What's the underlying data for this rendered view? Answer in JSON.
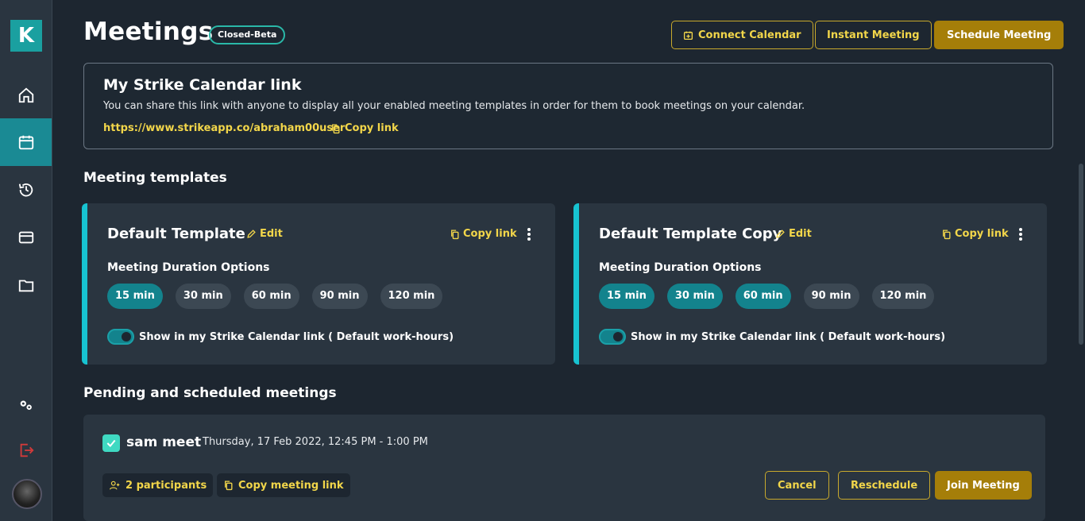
{
  "sidebar": {
    "logo_letter": "K",
    "items": [
      {
        "name": "home",
        "icon": "home-icon"
      },
      {
        "name": "calendar",
        "icon": "calendar-icon",
        "active": true
      },
      {
        "name": "history",
        "icon": "history-icon"
      },
      {
        "name": "card",
        "icon": "card-icon"
      },
      {
        "name": "folder",
        "icon": "folder-icon"
      }
    ],
    "bottom": [
      {
        "name": "settings",
        "icon": "settings-icon"
      },
      {
        "name": "logout",
        "icon": "logout-icon"
      }
    ]
  },
  "header": {
    "title": "Meetings",
    "badge": "Closed-Beta",
    "connect_calendar": "Connect Calendar",
    "instant_meeting": "Instant Meeting",
    "schedule_meeting": "Schedule Meeting"
  },
  "calendar_link": {
    "title": "My Strike Calendar link",
    "description": "You can share this link with anyone to display all your enabled meeting templates in order for them to book meetings on your calendar.",
    "url": "https://www.strikeapp.co/abraham00user",
    "copy_label": "Copy link"
  },
  "templates_section": {
    "title": "Meeting templates",
    "cards": [
      {
        "name": "Default Template",
        "edit_label": "Edit",
        "copy_label": "Copy link",
        "duration_label": "Meeting Duration Options",
        "durations": [
          {
            "label": "15 min",
            "on": true
          },
          {
            "label": "30 min",
            "on": false
          },
          {
            "label": "60 min",
            "on": false
          },
          {
            "label": "90 min",
            "on": false
          },
          {
            "label": "120 min",
            "on": false
          }
        ],
        "toggle_label": "Show in my Strike Calendar link ( Default work-hours)",
        "toggle_on": true
      },
      {
        "name": "Default Template Copy",
        "edit_label": "Edit",
        "copy_label": "Copy link",
        "duration_label": "Meeting Duration Options",
        "durations": [
          {
            "label": "15 min",
            "on": true
          },
          {
            "label": "30 min",
            "on": true
          },
          {
            "label": "60 min",
            "on": true
          },
          {
            "label": "90 min",
            "on": false
          },
          {
            "label": "120 min",
            "on": false
          }
        ],
        "toggle_label": "Show in my Strike Calendar link ( Default work-hours)",
        "toggle_on": true
      }
    ]
  },
  "meetings_section": {
    "title": "Pending and scheduled meetings",
    "meeting": {
      "title": "sam meet",
      "time": "Thursday, 17 Feb 2022, 12:45 PM - 1:00 PM",
      "participants": "2 participants",
      "copy_meeting_link": "Copy meeting link",
      "cancel": "Cancel",
      "reschedule": "Reschedule",
      "join": "Join Meeting"
    }
  },
  "colors": {
    "accent_gold": "#f2d64a",
    "button_gold": "#a57e09",
    "teal": "#13838d",
    "cyan_bar": "#17c3d1"
  }
}
